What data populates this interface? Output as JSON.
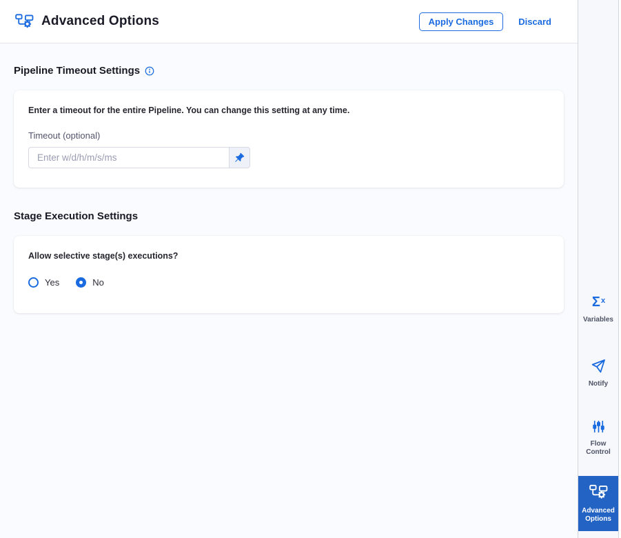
{
  "header": {
    "title": "Advanced Options",
    "apply_label": "Apply Changes",
    "discard_label": "Discard"
  },
  "pipeline_timeout": {
    "heading": "Pipeline Timeout Settings",
    "description": "Enter a timeout for the entire Pipeline. You can change this setting at any time.",
    "timeout_label": "Timeout (optional)",
    "timeout_placeholder": "Enter w/d/h/m/s/ms",
    "timeout_value": ""
  },
  "stage_execution": {
    "heading": "Stage Execution Settings",
    "question": "Allow selective stage(s) executions?",
    "options": [
      {
        "label": "Yes",
        "selected": false
      },
      {
        "label": "No",
        "selected": true
      }
    ]
  },
  "sidebar": {
    "items": [
      {
        "label": "Variables",
        "icon": "sigma-x-icon",
        "active": false
      },
      {
        "label": "Notify",
        "icon": "paper-plane-icon",
        "active": false
      },
      {
        "label": "Flow Control",
        "icon": "sliders-icon",
        "active": false
      },
      {
        "label": "Advanced Options",
        "icon": "pipeline-gear-icon",
        "active": true
      }
    ]
  },
  "colors": {
    "accent": "#1a6be0",
    "active_tile": "#2363c3",
    "content_bg": "#fafbfe"
  }
}
